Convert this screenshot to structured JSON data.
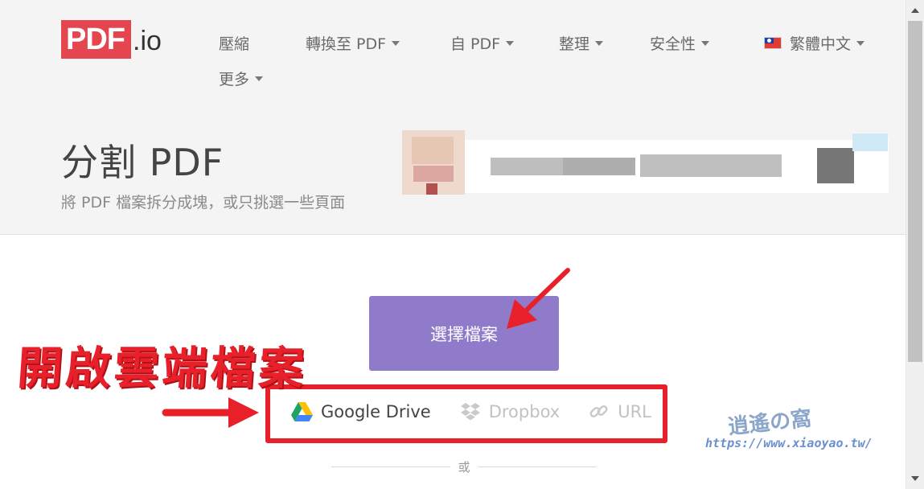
{
  "logo": {
    "main": "PDF",
    "suffix": ".io"
  },
  "nav": {
    "items": [
      {
        "label": "壓縮"
      },
      {
        "label": "轉換至 PDF"
      },
      {
        "label": "自 PDF"
      },
      {
        "label": "整理"
      },
      {
        "label": "安全性"
      },
      {
        "label": "更多"
      }
    ],
    "language": "繁體中文"
  },
  "page": {
    "title": "分割 PDF",
    "subtitle": "將 PDF 檔案拆分成塊，或只挑選一些頁面"
  },
  "main": {
    "choose_file": "選擇檔案",
    "sources": {
      "google_drive": "Google Drive",
      "dropbox": "Dropbox",
      "url": "URL"
    },
    "or_divider": "或"
  },
  "annotation": {
    "label": "開啟雲端檔案",
    "color": "#e8202a"
  },
  "watermark": {
    "logo_text": "逍遙の窩",
    "url": "https://www.xiaoyao.tw/"
  },
  "colors": {
    "brand_red": "#e5454e",
    "button_purple": "#8f7bc9",
    "hero_bg": "#f4f4f4"
  }
}
